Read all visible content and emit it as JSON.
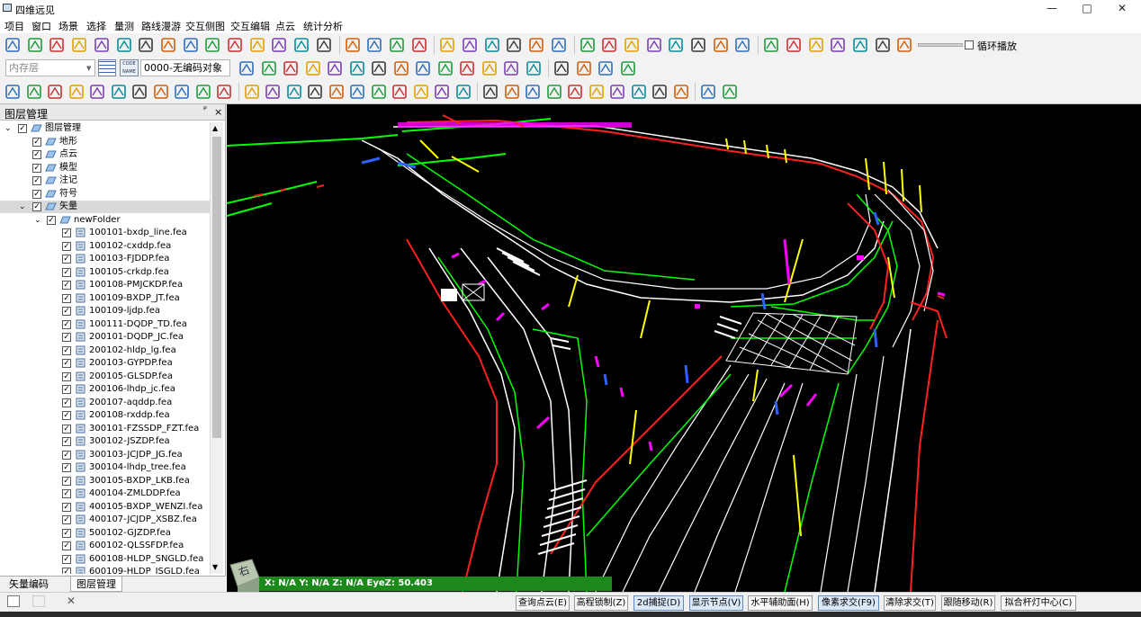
{
  "window": {
    "title": "四维远见",
    "controls": [
      "—",
      "□",
      "✕"
    ]
  },
  "menu": [
    "项目",
    "窗口",
    "场景",
    "选择",
    "量测",
    "路线漫游",
    "交互侧图",
    "交互编辑",
    "点云",
    "统计分析"
  ],
  "toolbar1": {
    "loop_play_label": "循环播放"
  },
  "toolbar2": {
    "layer_combo": "内存层",
    "code_combo": "0000-无编码对象",
    "btn_code": "CODE NAME"
  },
  "toolbar1_icons": [
    "open-icon",
    "save-icon",
    "delete-icon",
    "compass-icon",
    "list-icon",
    "edit-icon",
    "window-icon",
    "image-icon",
    "keyvalue-icon",
    "labelvalue-icon",
    "tools-icon",
    "vector-icon",
    "frame-icon",
    "wrench-icon",
    "tree-icon",
    "eye-icon",
    "wave-icon",
    "sun-icon",
    "pen-icon",
    "cursor-icon",
    "pencil-icon",
    "angle-icon",
    "house-icon",
    "building-icon",
    "stairs-icon",
    "hash-icon",
    "ruler-icon",
    "cube-icon",
    "bars-icon",
    "terrain-icon",
    "ship-icon",
    "antenna-icon",
    "cylinder-icon",
    "zoom-plus-icon",
    "globe1-icon",
    "globe2-icon",
    "globe3-icon",
    "play1-icon",
    "play2-icon",
    "play3-icon"
  ],
  "toolbar2_icons": [
    "crosshair-icon",
    "angle2-icon",
    "triangle-icon",
    "hexagon-icon",
    "number4-icon",
    "circle-square-icon",
    "rect-icon",
    "rect-corner-icon",
    "trapezoid-icon",
    "trapezoid2-icon",
    "arc-icon",
    "circle-icon",
    "ellipse-icon",
    "hatch-icon",
    "split-icon",
    "cut-icon",
    "join-icon",
    "join2-icon"
  ],
  "toolbar3_icons": [
    "poly-icon",
    "poly2-icon",
    "poly3-icon",
    "poly4-icon",
    "poly5-icon",
    "poly6-icon",
    "wline-icon",
    "corner-icon",
    "spiral-icon",
    "chevron-icon",
    "snap-icon",
    "frame2-icon",
    "columns-icon",
    "table-icon",
    "group-icon",
    "move-icon",
    "rotate-icon",
    "flip-icon",
    "scissors-icon",
    "key-icon",
    "curve-icon",
    "hline-icon",
    "grid-icon",
    "tree2-icon",
    "bridge-icon",
    "hatch2-icon",
    "stripes-icon",
    "texture-icon",
    "tower-icon",
    "arrow-set-icon",
    "scale-icon",
    "route-icon",
    "connect-icon",
    "layers-icon"
  ],
  "panel": {
    "title": "图层管理",
    "pin": "ᴾ",
    "close": "×",
    "root": "图层管理",
    "groups": [
      "地形",
      "点云",
      "模型",
      "注记",
      "符号",
      "矢量"
    ],
    "folder": "newFolder",
    "files": [
      "100101-bxdp_line.fea",
      "100102-cxddp.fea",
      "100103-FJDDP.fea",
      "100105-crkdp.fea",
      "100108-PMJCKDP.fea",
      "100109-BXDP_JT.fea",
      "100109-ljdp.fea",
      "100111-DQDP_TD.fea",
      "200101-DQDP_JC.fea",
      "200102-hldp_lg.fea",
      "200103-GYPDP.fea",
      "200105-GLSDP.fea",
      "200106-lhdp_jc.fea",
      "200107-aqddp.fea",
      "200108-rxddp.fea",
      "300101-FZSSDP_FZT.fea",
      "300102-JSZDP.fea",
      "300103-JCJDP_JG.fea",
      "300104-lhdp_tree.fea",
      "300105-BXDP_LKB.fea",
      "400104-ZMLDDP.fea",
      "400105-BXDP_WENZI.fea",
      "400107-JCJDP_XSBZ.fea",
      "500102-GJZDP.fea",
      "600102-QLSSFDP.fea",
      "600108-HLDP_SNGLD.fea",
      "600109-HLDP_JSGLD.fea"
    ],
    "tabs": [
      "矢量编码",
      "图层管理"
    ]
  },
  "viewport": {
    "coords": "X: N/A Y: N/A Z: N/A EyeZ: 50.403",
    "cube_label": "右",
    "colors": {
      "white": "#ffffff",
      "green": "#00ff00",
      "red": "#ff0000",
      "magenta": "#ff00ff",
      "yellow": "#ffff00",
      "blue": "#0000ff"
    }
  },
  "statusbar": {
    "buttons": [
      "查询点云(E)",
      "高程锁制(Z)",
      "2d捕捉(D)",
      "显示节点(V)",
      "水平辅助面(H)",
      "像素求交(F9)",
      "清除求交(T)",
      "跟随移动(R)",
      "拟合杆灯中心(C)"
    ],
    "active": [
      false,
      false,
      true,
      true,
      false,
      true,
      false,
      false,
      false
    ]
  }
}
